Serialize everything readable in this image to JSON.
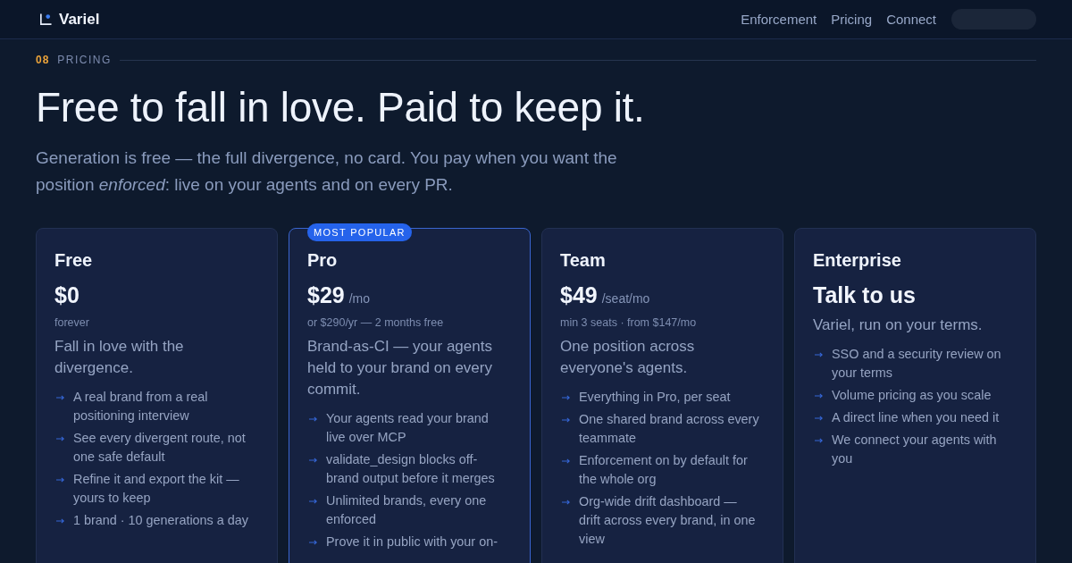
{
  "nav": {
    "brand": "Variel",
    "links": [
      "Enforcement",
      "Pricing",
      "Connect"
    ]
  },
  "section": {
    "number": "08",
    "label": "PRICING"
  },
  "headline": "Free to fall in love. Paid to keep it.",
  "intro": "Generation is free — the full divergence, no card. You pay when you want the position *enforced*: live on your agents and on every PR.",
  "plans": [
    {
      "name": "Free",
      "price": "$0",
      "note": "forever",
      "description": "Fall in love with the divergence.",
      "featured": false,
      "features": [
        "A real brand from a real positioning interview",
        "See every divergent route, not one safe default",
        "Refine it and export the kit — yours to keep",
        "1 brand · 10 generations a day"
      ]
    },
    {
      "name": "Pro",
      "badge": "MOST POPULAR",
      "price": "$29",
      "period": "/mo",
      "note": "or $290/yr — 2 months free",
      "description": "Brand-as-CI — your agents held to your brand on every commit.",
      "featured": true,
      "features": [
        "Your agents read your brand live over MCP",
        "validate_design blocks off-brand output before it merges",
        "Unlimited brands, every one enforced",
        "Prove it in public with your on-"
      ]
    },
    {
      "name": "Team",
      "price": "$49",
      "period": "/seat/mo",
      "note": "min 3 seats · from $147/mo",
      "description": "One position across everyone's agents.",
      "featured": false,
      "features": [
        "Everything in Pro, per seat",
        "One shared brand across every teammate",
        "Enforcement on by default for the whole org",
        "Org-wide drift dashboard — drift across every brand, in one view"
      ]
    },
    {
      "name": "Enterprise",
      "price": "Talk to us",
      "description": "Variel, run on your terms.",
      "featured": false,
      "features": [
        "SSO and a security review on your terms",
        "Volume pricing as you scale",
        "A direct line when you need it",
        "We connect your agents with you"
      ]
    }
  ]
}
